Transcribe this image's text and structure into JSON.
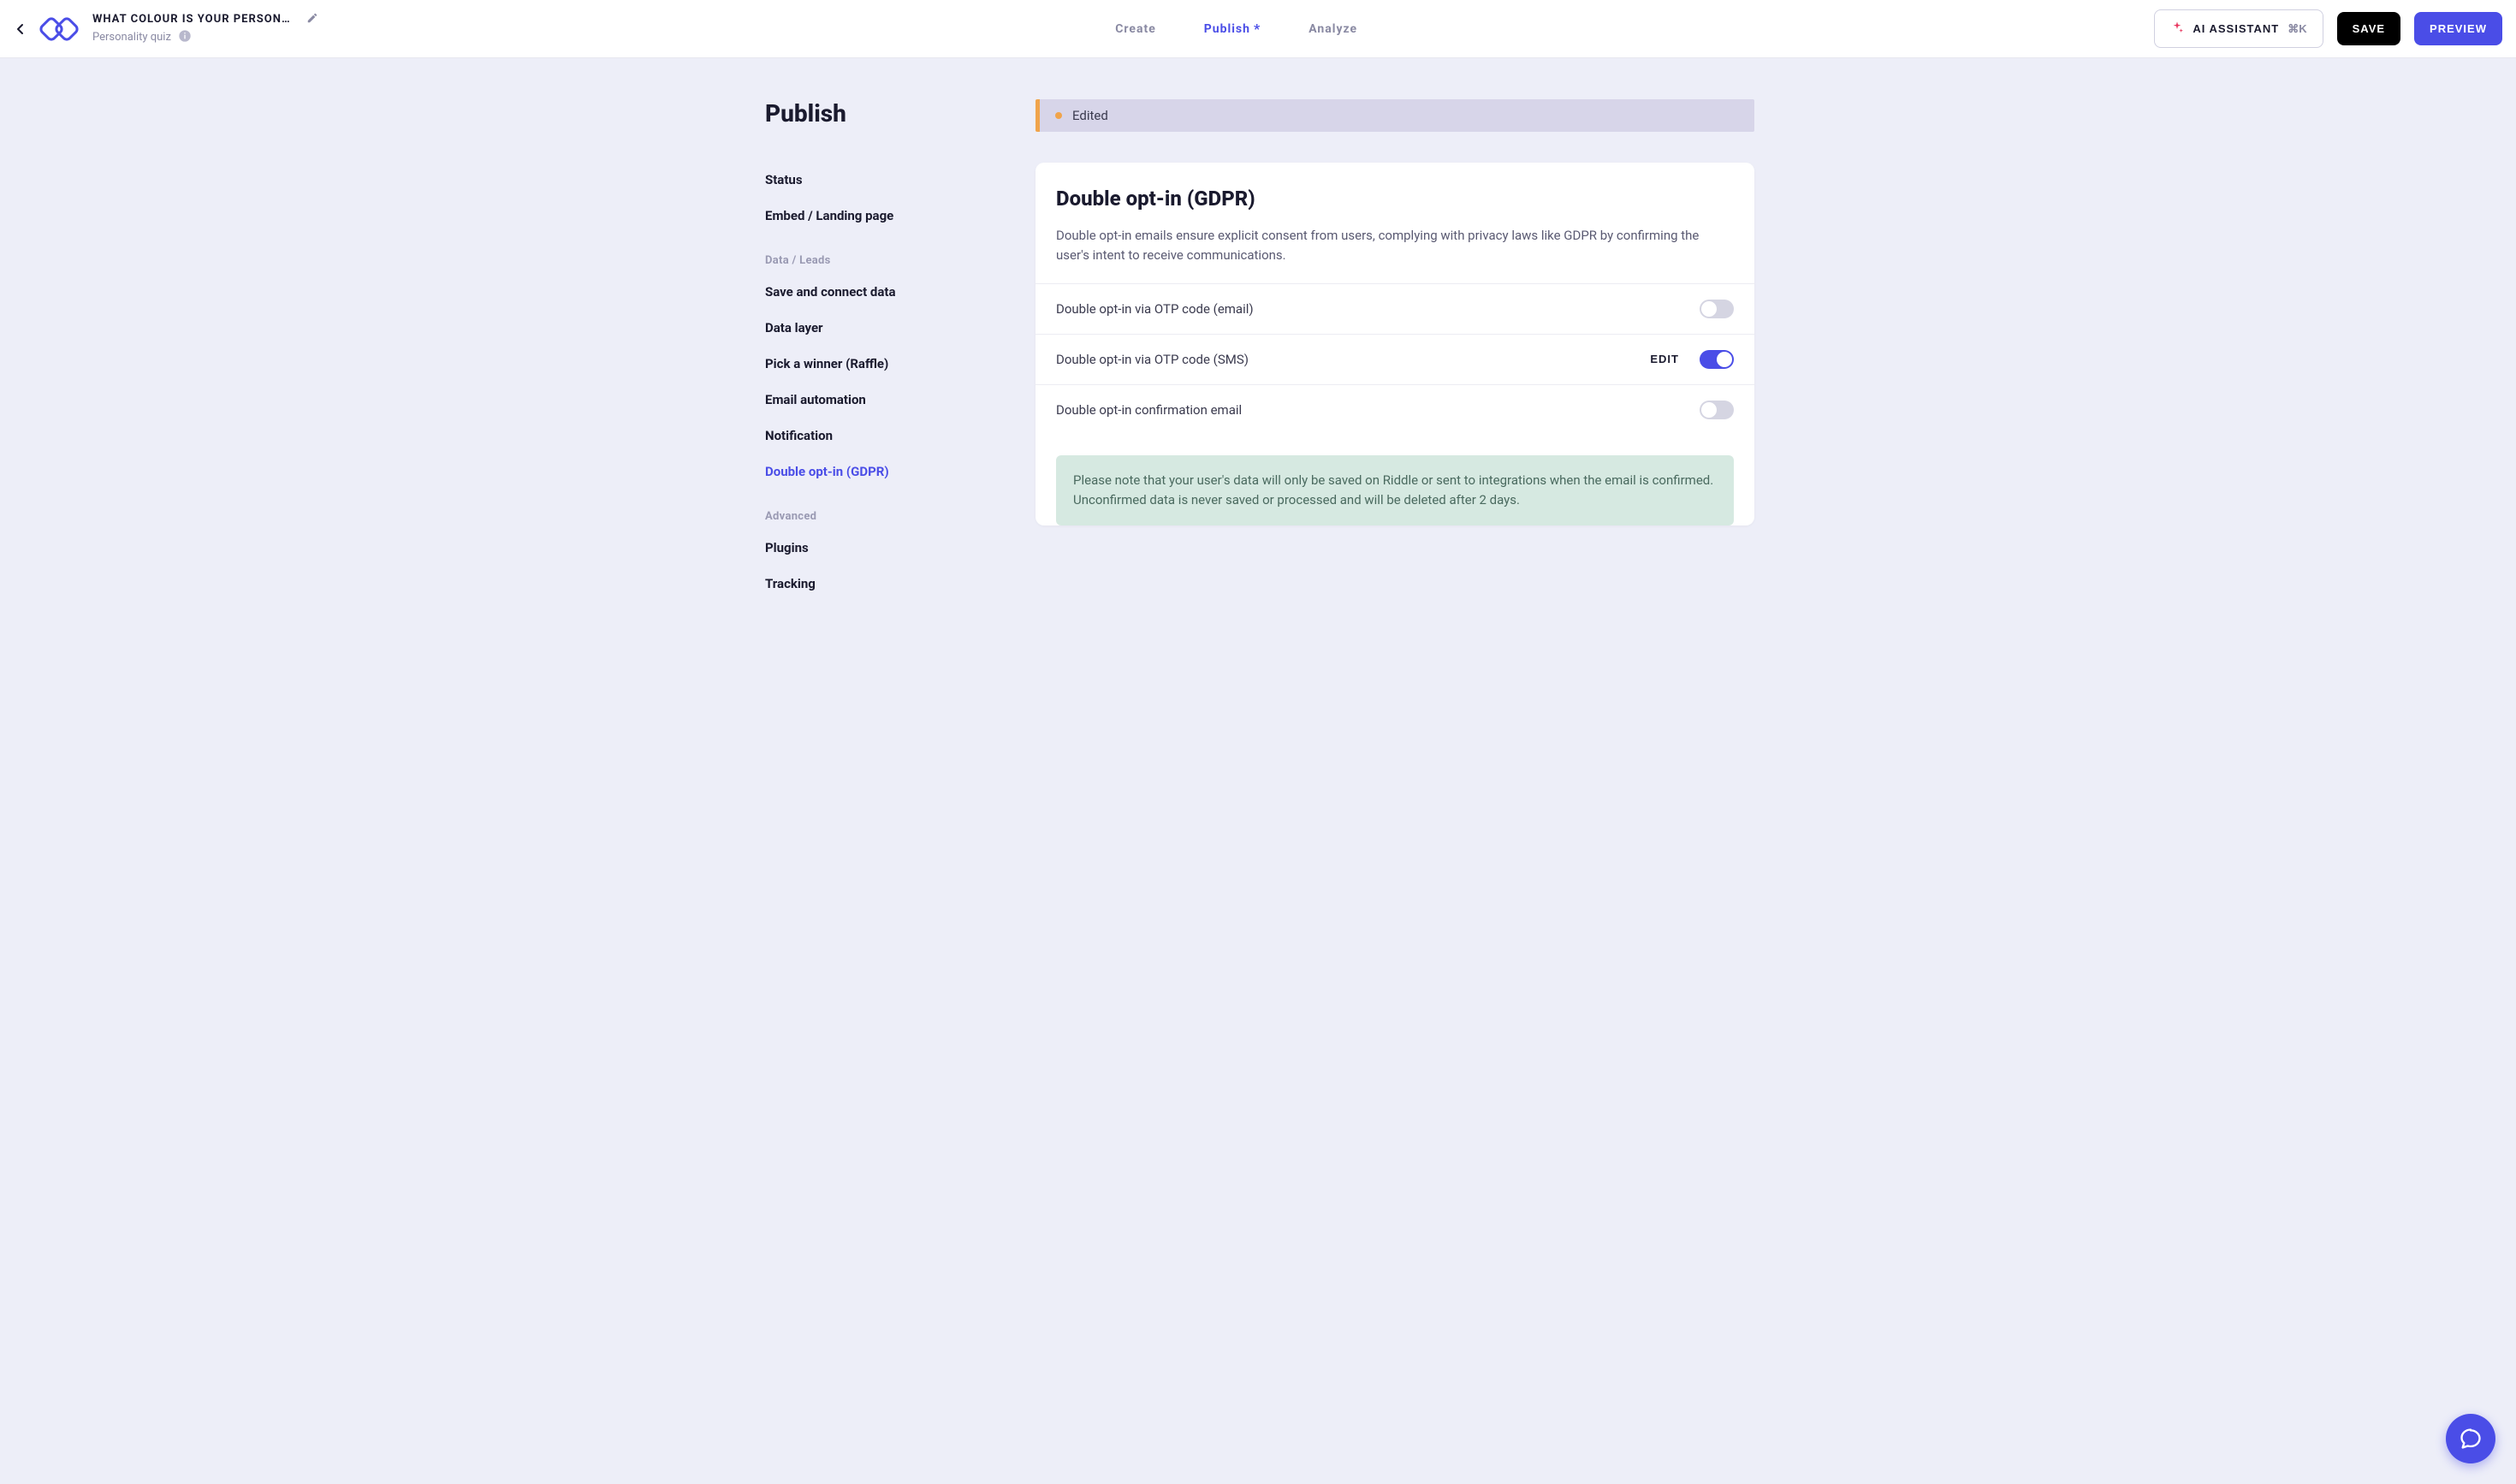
{
  "header": {
    "title": "WHAT COLOUR IS YOUR PERSONA…",
    "subtitle": "Personality quiz",
    "tabs": {
      "create": "Create",
      "publish": "Publish",
      "analyze": "Analyze"
    },
    "publish_dirty_indicator": "*",
    "ai_button": "AI ASSISTANT",
    "ai_shortcut": "⌘K",
    "save": "SAVE",
    "preview": "PREVIEW"
  },
  "sidebar": {
    "page_title": "Publish",
    "items": {
      "status": "Status",
      "embed": "Embed / Landing page",
      "save_connect": "Save and connect data",
      "data_layer": "Data layer",
      "raffle": "Pick a winner (Raffle)",
      "email_automation": "Email automation",
      "notification": "Notification",
      "double_opt_in": "Double opt-in (GDPR)",
      "plugins": "Plugins",
      "tracking": "Tracking"
    },
    "groups": {
      "data_leads": "Data / Leads",
      "advanced": "Advanced"
    }
  },
  "banner": {
    "status": "Edited"
  },
  "card": {
    "title": "Double opt-in (GDPR)",
    "description": "Double opt-in emails ensure explicit consent from users, complying with privacy laws like GDPR by confirming the user's intent to receive communications.",
    "rows": {
      "otp_email": {
        "label": "Double opt-in via OTP code (email)",
        "enabled": false
      },
      "otp_sms": {
        "label": "Double opt-in via OTP code (SMS)",
        "enabled": true,
        "edit_label": "EDIT"
      },
      "conf_email": {
        "label": "Double opt-in confirmation email",
        "enabled": false
      }
    },
    "note": "Please note that your user's data will only be saved on Riddle or sent to integrations when the email is confirmed. Unconfirmed data is never saved or processed and will be deleted after 2 days."
  }
}
